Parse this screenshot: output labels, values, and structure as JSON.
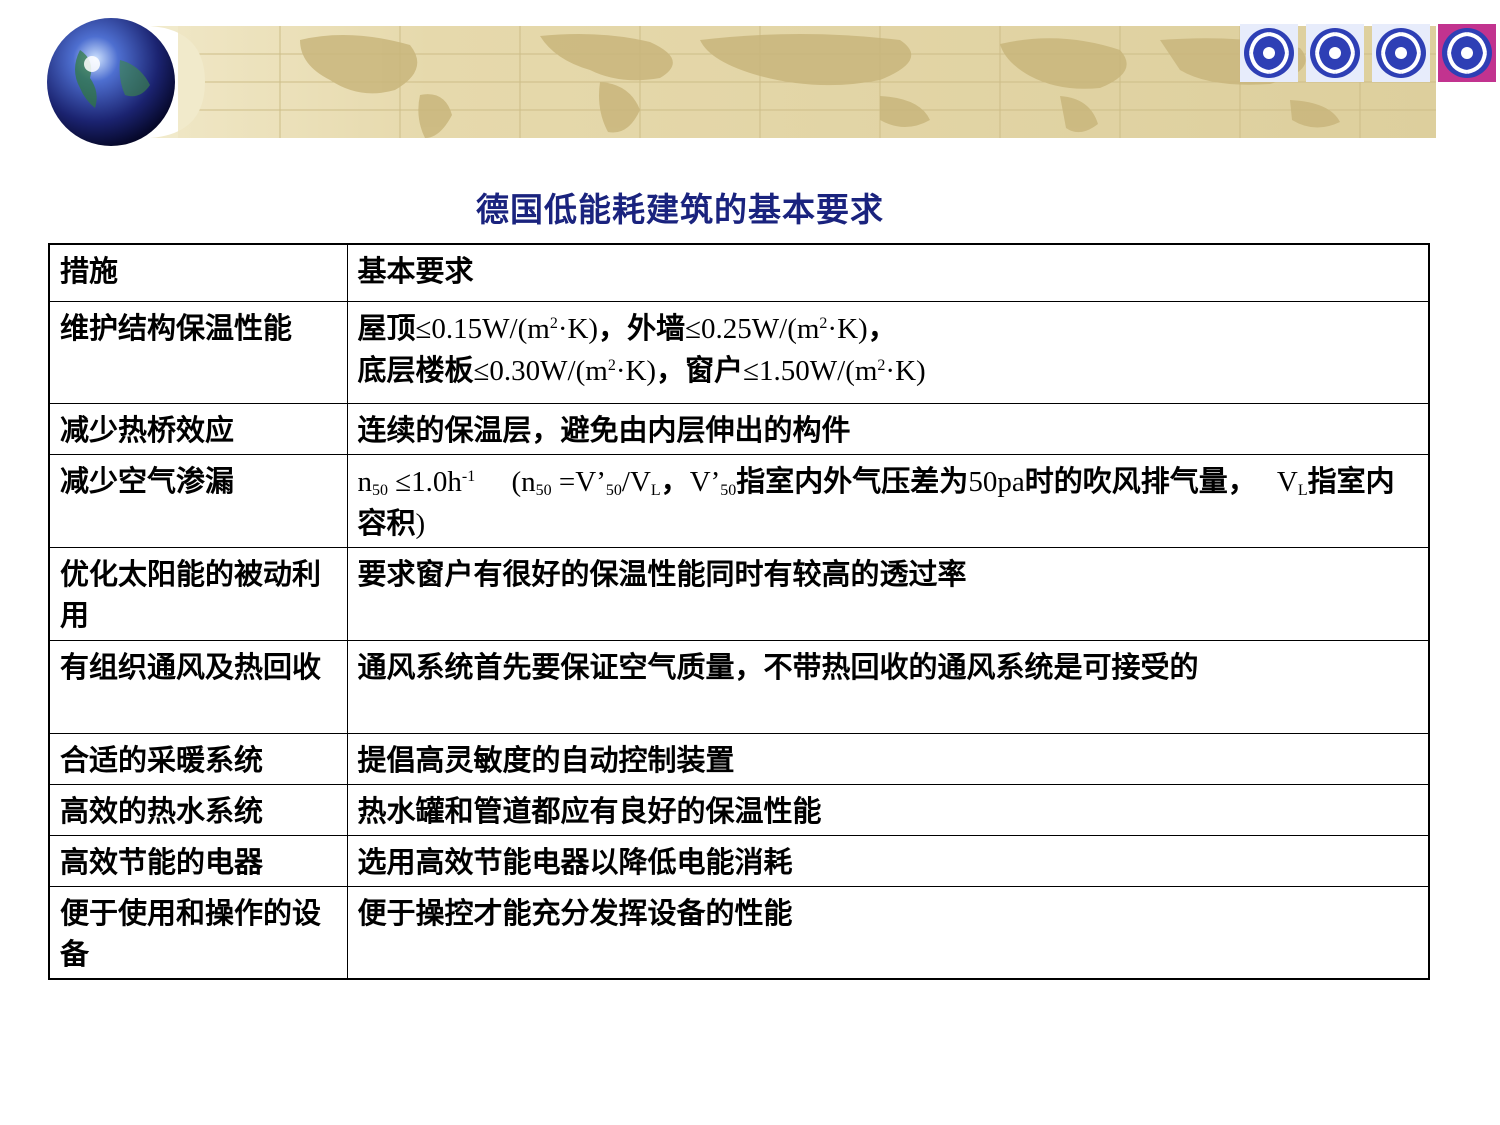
{
  "slide": {
    "title": "德国低能耗建筑的基本要求",
    "colors": {
      "title": "#1a237e",
      "banner_map": "#d9c99a",
      "icon_blue": "#2e3fb5",
      "icon_active": "#c2338f"
    },
    "icons": [
      "globe-icon",
      "swirl-icon",
      "swirl-icon",
      "swirl-icon",
      "swirl-icon-active"
    ]
  },
  "table": {
    "header": {
      "measure": "措施",
      "requirement": "基本要求"
    },
    "rows": [
      {
        "measure": "维护结构保温性能",
        "req": {
          "roof_label": "屋顶",
          "roof_val": "≤0.15W/(m",
          "roof_unit": "·K)",
          "wall_label": "，外墙",
          "wall_val": "≤0.25W/(m",
          "wall_unit": "·K)",
          "sep": "，",
          "floor_label": "底层楼板",
          "floor_val": "≤0.30W/(m",
          "floor_unit": "·K)",
          "window_label": "，窗户",
          "window_val": "≤1.50W/(m",
          "window_unit": "·K)",
          "exp": "2"
        }
      },
      {
        "measure": "减少热桥效应",
        "requirement": "连续的保温层，避免由内层伸出的构件"
      },
      {
        "measure": "减少空气渗漏",
        "req": {
          "n": "n",
          "n_sub": "50",
          "limit": " ≤1.0h",
          "limit_sup": "-1",
          "open": "(n",
          "n_sub2": "50",
          "eq": " =V’",
          "v_sub": "50",
          "slash": "/V",
          "l_sub": "L",
          "comma": "，",
          "v2": "V’",
          "v2_sub": "50",
          "text1": "指室内外气压差为",
          "pa": "50pa",
          "text2": "时的吹风排气量，",
          "vl": "V",
          "vl_sub": "L",
          "text3": "指室内容积",
          "close": ")"
        }
      },
      {
        "measure": "优化太阳能的被动利用",
        "requirement": "要求窗户有很好的保温性能同时有较高的透过率"
      },
      {
        "measure": "有组织通风及热回收",
        "requirement": "通风系统首先要保证空气质量，不带热回收的通风系统是可接受的"
      },
      {
        "measure": "合适的采暖系统",
        "requirement": "提倡高灵敏度的自动控制装置"
      },
      {
        "measure": "高效的热水系统",
        "requirement": "热水罐和管道都应有良好的保温性能"
      },
      {
        "measure": "高效节能的电器",
        "requirement": "选用高效节能电器以降低电能消耗"
      },
      {
        "measure": "便于使用和操作的设备",
        "requirement": "便于操控才能充分发挥设备的性能"
      }
    ]
  }
}
